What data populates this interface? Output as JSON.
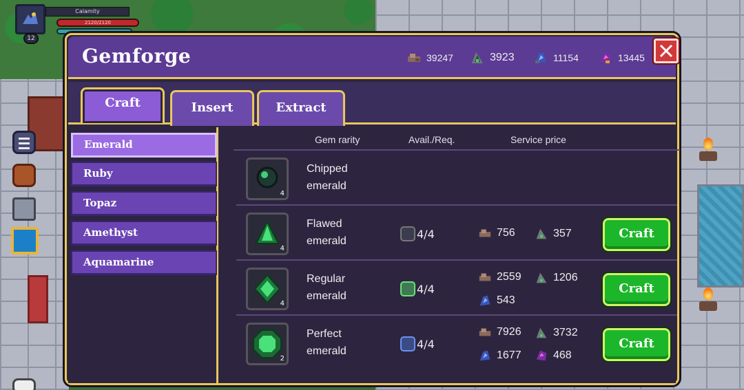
{
  "player": {
    "name": "Calamity",
    "hp_text": "2120/2120",
    "level": "12"
  },
  "window": {
    "title": "Gemforge",
    "close_icon": "close-icon"
  },
  "currencies": [
    {
      "icon": "ore-dust-icon",
      "value": "39247"
    },
    {
      "icon": "green-shard-icon",
      "value": "3923"
    },
    {
      "icon": "blue-shard-icon",
      "value": "11154"
    },
    {
      "icon": "purple-shard-icon",
      "value": "13445"
    }
  ],
  "tabs": [
    {
      "label": "Craft",
      "active": true
    },
    {
      "label": "Insert",
      "active": false
    },
    {
      "label": "Extract",
      "active": false
    }
  ],
  "gems": [
    {
      "label": "Emerald",
      "active": true
    },
    {
      "label": "Ruby",
      "active": false
    },
    {
      "label": "Topaz",
      "active": false
    },
    {
      "label": "Amethyst",
      "active": false
    },
    {
      "label": "Aquamarine",
      "active": false
    }
  ],
  "table": {
    "headers": {
      "rarity": "Gem rarity",
      "avail": "Avail./Req.",
      "price": "Service price"
    },
    "rows": [
      {
        "name_line1": "Chipped",
        "name_line2": "emerald",
        "count": "4",
        "req": "",
        "prices": [],
        "craft": ""
      },
      {
        "name_line1": "Flawed",
        "name_line2": "emerald",
        "count": "4",
        "req": "4/4",
        "prices": [
          {
            "icon": "ore-dust-icon",
            "value": "756"
          },
          {
            "icon": "green-shard-icon",
            "value": "357"
          }
        ],
        "craft": "Craft"
      },
      {
        "name_line1": "Regular",
        "name_line2": "emerald",
        "count": "4",
        "req": "4/4",
        "prices": [
          {
            "icon": "ore-dust-icon",
            "value": "2559"
          },
          {
            "icon": "green-shard-icon",
            "value": "1206"
          },
          {
            "icon": "blue-shard-icon",
            "value": "543"
          }
        ],
        "craft": "Craft"
      },
      {
        "name_line1": "Perfect",
        "name_line2": "emerald",
        "count": "2",
        "req": "4/4",
        "prices": [
          {
            "icon": "ore-dust-icon",
            "value": "7926"
          },
          {
            "icon": "green-shard-icon",
            "value": "3732"
          },
          {
            "icon": "blue-shard-icon",
            "value": "1677"
          },
          {
            "icon": "purple-shard-icon",
            "value": "468"
          }
        ],
        "craft": "Craft"
      }
    ]
  },
  "colors": {
    "window_bg": "#2d2540",
    "title_bar": "#5b3b94",
    "gold_border": "#e9c85a",
    "craft_green": "#1cb62a",
    "close_red": "#d23a3a"
  }
}
